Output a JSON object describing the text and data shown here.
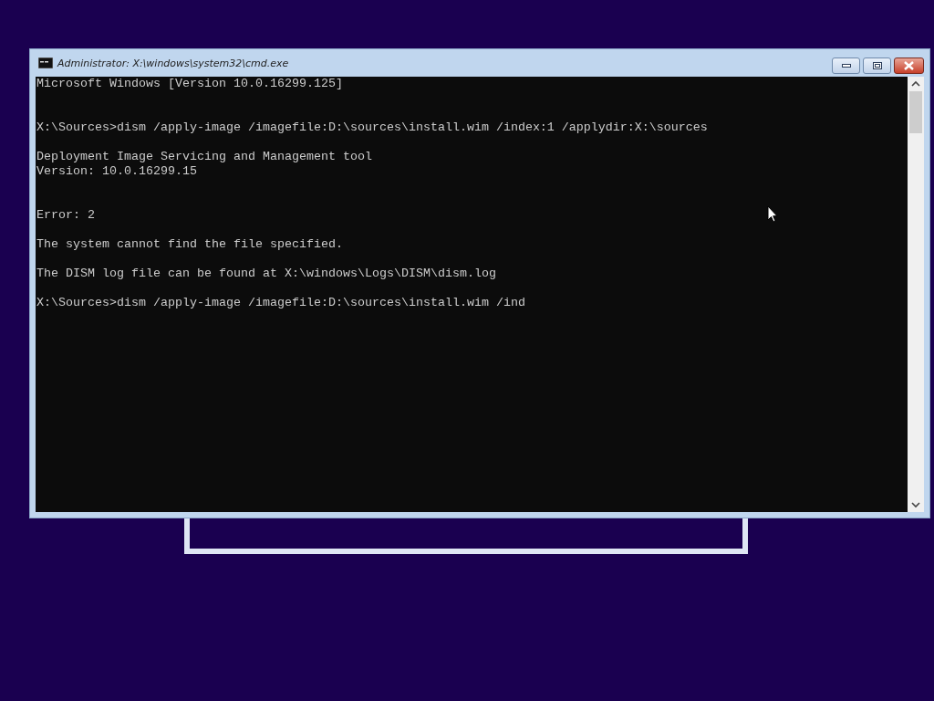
{
  "window": {
    "title": "Administrator: X:\\windows\\system32\\cmd.exe"
  },
  "console": {
    "lines": [
      {
        "kind": "text",
        "text": "Microsoft Windows [Version 10.0.16299.125]"
      },
      {
        "kind": "blank"
      },
      {
        "kind": "blank"
      },
      {
        "kind": "text",
        "text": "X:\\Sources>dism /apply-image /imagefile:D:\\sources\\install.wim /index:1 /applydir:X:\\sources"
      },
      {
        "kind": "blank"
      },
      {
        "kind": "text",
        "text": "Deployment Image Servicing and Management tool"
      },
      {
        "kind": "text",
        "text": "Version: 10.0.16299.15"
      },
      {
        "kind": "blank"
      },
      {
        "kind": "blank"
      },
      {
        "kind": "text",
        "text": "Error: 2"
      },
      {
        "kind": "blank"
      },
      {
        "kind": "text",
        "text": "The system cannot find the file specified."
      },
      {
        "kind": "blank"
      },
      {
        "kind": "text",
        "text": "The DISM log file can be found at X:\\windows\\Logs\\DISM\\dism.log"
      },
      {
        "kind": "blank"
      },
      {
        "kind": "text",
        "text": "X:\\Sources>dism /apply-image /imagefile:D:\\sources\\install.wim /ind"
      }
    ]
  }
}
